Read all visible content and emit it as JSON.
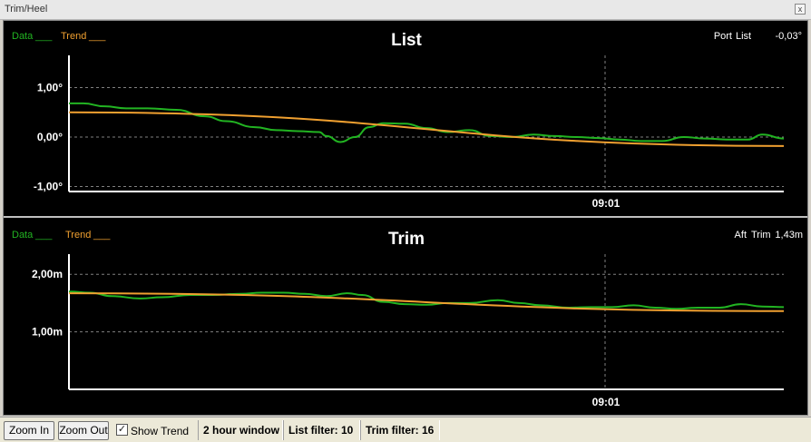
{
  "window": {
    "title": "Trim/Heel",
    "close_glyph": "x"
  },
  "colors": {
    "data_series": "#22b422",
    "trend_series": "#f0a030",
    "grid": "#808080",
    "axis": "#ffffff",
    "text": "#ffffff"
  },
  "list_chart": {
    "title": "List",
    "legend": {
      "data": "Data",
      "trend": "Trend",
      "underline": "___"
    },
    "readout": {
      "side": "Port",
      "label": "List",
      "value": "-0,03°"
    },
    "y_tick_labels": [
      "1,00°",
      "0,00°",
      "-1,00°"
    ],
    "x_tick_label": "09:01"
  },
  "trim_chart": {
    "title": "Trim",
    "legend": {
      "data": "Data",
      "trend": "Trend",
      "underline": "___"
    },
    "readout": {
      "side": "Aft",
      "label": "Trim",
      "value": "1,43m"
    },
    "y_tick_labels": [
      "2,00m",
      "1,00m"
    ],
    "x_tick_label": "09:01"
  },
  "chart_data": [
    {
      "type": "line",
      "title": "List",
      "ylim": [
        -1.1,
        1.65
      ],
      "y_ticks": [
        1.0,
        0.0,
        -1.0
      ],
      "grid": true,
      "x_marker": 0.75,
      "series": [
        {
          "name": "Data",
          "x": [
            0,
            0.02,
            0.05,
            0.08,
            0.11,
            0.15,
            0.19,
            0.22,
            0.26,
            0.29,
            0.32,
            0.35,
            0.36,
            0.38,
            0.4,
            0.42,
            0.44,
            0.47,
            0.5,
            0.53,
            0.56,
            0.59,
            0.62,
            0.65,
            0.68,
            0.71,
            0.74,
            0.77,
            0.8,
            0.83,
            0.86,
            0.89,
            0.92,
            0.95,
            0.97,
            1.0
          ],
          "y": [
            0.68,
            0.68,
            0.62,
            0.58,
            0.58,
            0.55,
            0.42,
            0.32,
            0.2,
            0.14,
            0.12,
            0.1,
            0.02,
            -0.1,
            0.0,
            0.2,
            0.28,
            0.27,
            0.18,
            0.1,
            0.14,
            0.02,
            0.0,
            0.05,
            0.02,
            0.0,
            -0.02,
            -0.05,
            -0.08,
            -0.08,
            0.0,
            -0.03,
            -0.05,
            -0.05,
            0.05,
            -0.03
          ]
        },
        {
          "name": "Trend",
          "x": [
            0,
            1.0
          ],
          "y": [
            0.5,
            -0.18
          ]
        }
      ]
    },
    {
      "type": "line",
      "title": "Trim",
      "ylim": [
        0.0,
        2.35
      ],
      "y_ticks": [
        2.0,
        1.0
      ],
      "grid": true,
      "x_marker": 0.75,
      "series": [
        {
          "name": "Data",
          "x": [
            0,
            0.03,
            0.06,
            0.1,
            0.13,
            0.17,
            0.2,
            0.24,
            0.27,
            0.3,
            0.33,
            0.36,
            0.39,
            0.41,
            0.44,
            0.47,
            0.5,
            0.53,
            0.56,
            0.6,
            0.63,
            0.66,
            0.7,
            0.73,
            0.76,
            0.79,
            0.82,
            0.85,
            0.88,
            0.91,
            0.94,
            0.97,
            1.0
          ],
          "y": [
            1.7,
            1.68,
            1.62,
            1.58,
            1.6,
            1.64,
            1.64,
            1.66,
            1.68,
            1.68,
            1.66,
            1.62,
            1.67,
            1.64,
            1.52,
            1.48,
            1.47,
            1.5,
            1.5,
            1.55,
            1.5,
            1.46,
            1.42,
            1.43,
            1.43,
            1.46,
            1.42,
            1.4,
            1.42,
            1.42,
            1.48,
            1.44,
            1.43
          ]
        },
        {
          "name": "Trend",
          "x": [
            0,
            1.0
          ],
          "y": [
            1.67,
            1.36
          ]
        }
      ]
    }
  ],
  "statusbar": {
    "zoom_in": "Zoom In",
    "zoom_out": "Zoom Out",
    "show_trend": {
      "label": "Show Trend",
      "checked": true
    },
    "window": "2 hour window",
    "list_filter": "List filter: 10",
    "trim_filter": "Trim filter: 16"
  }
}
